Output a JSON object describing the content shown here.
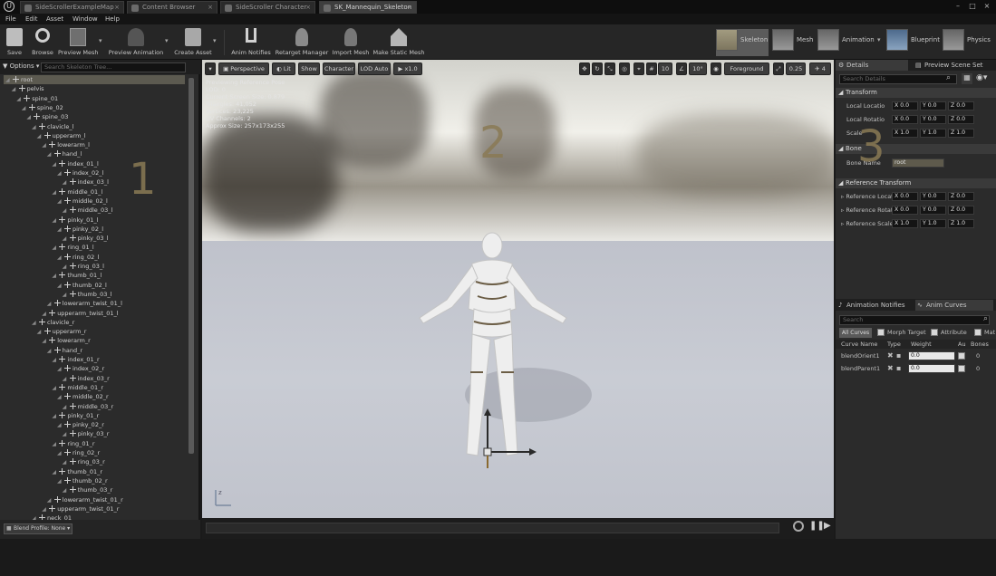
{
  "titlebar": {
    "tabs": [
      "SideScrollerExampleMap",
      "Content Browser",
      "SideScroller Character",
      "SK_Mannequin_Skeleton"
    ],
    "window_controls": [
      "minimize-icon",
      "maximize-icon",
      "close-icon"
    ]
  },
  "menubar": {
    "items": [
      "File",
      "Edit",
      "Asset",
      "Window",
      "Help"
    ]
  },
  "toolbar": {
    "save": "Save",
    "browse": "Browse",
    "preview_mesh": "Preview Mesh",
    "preview_animation": "Preview Animation",
    "create_asset": "Create Asset",
    "anim_notifies": "Anim Notifies",
    "retarget_manager": "Retarget Manager",
    "import_mesh": "Import Mesh",
    "make_static_mesh": "Make Static Mesh",
    "modes": [
      "Skeleton",
      "Mesh",
      "Animation",
      "Blueprint",
      "Physics"
    ]
  },
  "left": {
    "options": "Options",
    "search_placeholder": "Search Skeleton Tree...",
    "footer": "Blend Profile: None",
    "bones": [
      {
        "n": "root",
        "d": 0
      },
      {
        "n": "pelvis",
        "d": 1
      },
      {
        "n": "spine_01",
        "d": 2
      },
      {
        "n": "spine_02",
        "d": 3
      },
      {
        "n": "spine_03",
        "d": 4
      },
      {
        "n": "clavicle_l",
        "d": 5
      },
      {
        "n": "upperarm_l",
        "d": 6
      },
      {
        "n": "lowerarm_l",
        "d": 7
      },
      {
        "n": "hand_l",
        "d": 8
      },
      {
        "n": "index_01_l",
        "d": 9
      },
      {
        "n": "index_02_l",
        "d": 10
      },
      {
        "n": "index_03_l",
        "d": 11
      },
      {
        "n": "middle_01_l",
        "d": 9
      },
      {
        "n": "middle_02_l",
        "d": 10
      },
      {
        "n": "middle_03_l",
        "d": 11
      },
      {
        "n": "pinky_01_l",
        "d": 9
      },
      {
        "n": "pinky_02_l",
        "d": 10
      },
      {
        "n": "pinky_03_l",
        "d": 11
      },
      {
        "n": "ring_01_l",
        "d": 9
      },
      {
        "n": "ring_02_l",
        "d": 10
      },
      {
        "n": "ring_03_l",
        "d": 11
      },
      {
        "n": "thumb_01_l",
        "d": 9
      },
      {
        "n": "thumb_02_l",
        "d": 10
      },
      {
        "n": "thumb_03_l",
        "d": 11
      },
      {
        "n": "lowerarm_twist_01_l",
        "d": 8
      },
      {
        "n": "upperarm_twist_01_l",
        "d": 7
      },
      {
        "n": "clavicle_r",
        "d": 5
      },
      {
        "n": "upperarm_r",
        "d": 6
      },
      {
        "n": "lowerarm_r",
        "d": 7
      },
      {
        "n": "hand_r",
        "d": 8
      },
      {
        "n": "index_01_r",
        "d": 9
      },
      {
        "n": "index_02_r",
        "d": 10
      },
      {
        "n": "index_03_r",
        "d": 11
      },
      {
        "n": "middle_01_r",
        "d": 9
      },
      {
        "n": "middle_02_r",
        "d": 10
      },
      {
        "n": "middle_03_r",
        "d": 11
      },
      {
        "n": "pinky_01_r",
        "d": 9
      },
      {
        "n": "pinky_02_r",
        "d": 10
      },
      {
        "n": "pinky_03_r",
        "d": 11
      },
      {
        "n": "ring_01_r",
        "d": 9
      },
      {
        "n": "ring_02_r",
        "d": 10
      },
      {
        "n": "ring_03_r",
        "d": 11
      },
      {
        "n": "thumb_01_r",
        "d": 9
      },
      {
        "n": "thumb_02_r",
        "d": 10
      },
      {
        "n": "thumb_03_r",
        "d": 11
      },
      {
        "n": "lowerarm_twist_01_r",
        "d": 8
      },
      {
        "n": "upperarm_twist_01_r",
        "d": 7
      },
      {
        "n": "neck_01",
        "d": 5
      }
    ],
    "marker": "1"
  },
  "viewport": {
    "perspective": "Perspective",
    "lit": "Lit",
    "show": "Show",
    "character": "Character",
    "lod": "LOD Auto",
    "speed": "x1.0",
    "grid_snap": "10",
    "rot_snap": "10°",
    "foreground": "Foreground",
    "scale_snap": "0.25",
    "cam_speed": "4",
    "info": [
      "Previewing Reference Pose",
      "LOD: 0",
      "Current Screen Size: 0.879",
      "Triangles: 41,052",
      "Vertices: 23,225",
      "UV Channels: 2",
      "Approx Size: 257x173x255"
    ],
    "marker": "2"
  },
  "right": {
    "tab_details": "Details",
    "tab_preview": "Preview Scene Set",
    "search_placeholder": "Search Details",
    "transform": "Transform",
    "local_location": "Local Locatio",
    "local_rotation": "Local Rotatio",
    "scale": "Scale",
    "loc": [
      "0.0",
      "0.0",
      "0.0"
    ],
    "rot": [
      "0.0",
      "0.0",
      "0.0"
    ],
    "scl": [
      "1.0",
      "1.0",
      "1.0"
    ],
    "bone": "Bone",
    "bone_name_label": "Bone Name",
    "bone_name": "root",
    "ref_transform": "Reference Transform",
    "ref_location": "Reference Locat",
    "ref_rotation": "Reference Rotat",
    "ref_scale": "Reference Scale",
    "rloc": [
      "0.0",
      "0.0",
      "0.0"
    ],
    "rrot": [
      "0.0",
      "0.0",
      "0.0"
    ],
    "rscl": [
      "1.0",
      "1.0",
      "1.0"
    ],
    "marker": "3",
    "tab_notifies": "Animation Notifies",
    "tab_curves": "Anim Curves",
    "curve_search": "Search",
    "filters": [
      "All Curves",
      "Morph Target",
      "Attribute",
      "Mate"
    ],
    "headers": [
      "Curve Name",
      "Type",
      "Weight",
      "Au",
      "Bones"
    ],
    "curves": [
      {
        "name": "blendOrient1",
        "weight": "0.0",
        "bones": "0"
      },
      {
        "name": "blendParent1",
        "weight": "0.0",
        "bones": "0"
      }
    ]
  }
}
